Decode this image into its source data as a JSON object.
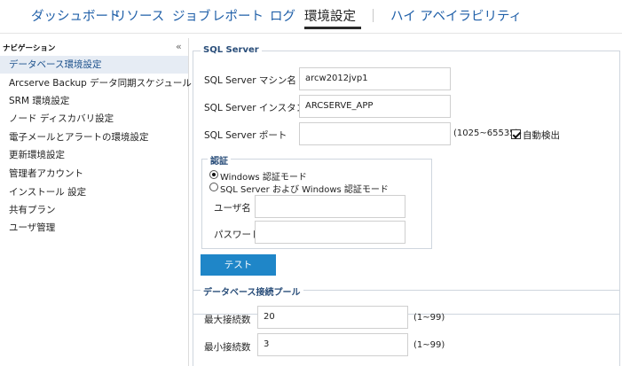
{
  "nav": {
    "items": [
      "ダッシュボード",
      "リソース",
      "ジョブ",
      "レポート",
      "ログ",
      "環境設定",
      "ハイ アベイラビリティ"
    ],
    "active_index": 5
  },
  "sidebar": {
    "title": "ナビゲーション",
    "items": [
      "データベース環境設定",
      "Arcserve Backup データ同期スケジュール",
      "SRM 環境設定",
      "ノード ディスカバリ設定",
      "電子メールとアラートの環境設定",
      "更新環境設定",
      "管理者アカウント",
      "インストール 設定",
      "共有プラン",
      "ユーザ管理"
    ],
    "active_index": 0
  },
  "sql_server": {
    "legend": "SQL Server",
    "machine_label": "SQL Server マシン名",
    "machine_value": "arcw2012jvp1",
    "instance_label": "SQL Server インスタンス",
    "instance_value": "ARCSERVE_APP",
    "port_label": "SQL Server ポート",
    "port_value": "",
    "port_range": "(1025~65535)",
    "auto_detect_label": "自動検出",
    "auto_detect_checked": true
  },
  "auth": {
    "legend": "認証",
    "windows_mode_label": "Windows 認証モード",
    "sql_mode_label": "SQL Server および Windows 認証モード",
    "selected": "windows",
    "username_label": "ユーザ名",
    "username_value": "",
    "password_label": "パスワード",
    "password_value": "",
    "test_button": "テスト"
  },
  "pool": {
    "legend": "データベース接続プール",
    "max_label": "最大接続数",
    "max_value": "20",
    "max_range": "(1~99)",
    "min_label": "最小接続数",
    "min_value": "3",
    "min_range": "(1~99)"
  },
  "colors": {
    "nav_link": "#1f5fa8",
    "accent_button": "#1f86c8",
    "sidebar_active_bg": "#e6ecf4"
  }
}
